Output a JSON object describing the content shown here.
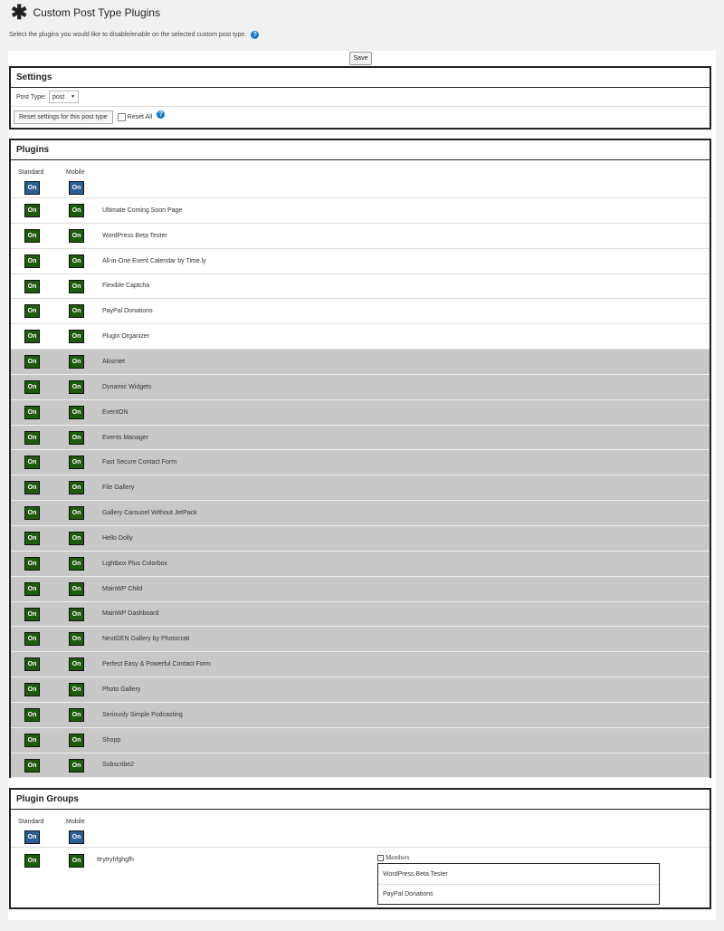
{
  "page": {
    "title": "Custom Post Type Plugins",
    "description": "Select the plugins you would like to disable/enable on the selected custom post type.",
    "save_label": "Save"
  },
  "settings": {
    "heading": "Settings",
    "post_type_label": "Post Type:",
    "post_type_value": "post",
    "reset_button": "Reset settings for this post type",
    "reset_all_label": "Reset All"
  },
  "plugins": {
    "heading": "Plugins",
    "col_standard": "Standard",
    "col_mobile": "Mobile",
    "toggle_label": "On",
    "items": [
      {
        "name": "Ultimate Coming Soon Page",
        "gray": false
      },
      {
        "name": "WordPress Beta Tester",
        "gray": false
      },
      {
        "name": "All-in-One Event Calendar by Time.ly",
        "gray": false
      },
      {
        "name": "Flexible Captcha",
        "gray": false
      },
      {
        "name": "PayPal Donations",
        "gray": false
      },
      {
        "name": "Plugin Organizer",
        "gray": false
      },
      {
        "name": "Akismet",
        "gray": true
      },
      {
        "name": "Dynamic Widgets",
        "gray": true
      },
      {
        "name": "EventON",
        "gray": true
      },
      {
        "name": "Events Manager",
        "gray": true
      },
      {
        "name": "Fast Secure Contact Form",
        "gray": true
      },
      {
        "name": "File Gallery",
        "gray": true
      },
      {
        "name": "Gallery Carousel Without JetPack",
        "gray": true
      },
      {
        "name": "Hello Dolly",
        "gray": true
      },
      {
        "name": "Lightbox Plus Colorbox",
        "gray": true
      },
      {
        "name": "MainWP Child",
        "gray": true
      },
      {
        "name": "MainWP Dashboard",
        "gray": true
      },
      {
        "name": "NextGEN Gallery by Photocrati",
        "gray": true
      },
      {
        "name": "Perfect Easy & Powerful Contact Form",
        "gray": true
      },
      {
        "name": "Photo Gallery",
        "gray": true
      },
      {
        "name": "Seriously Simple Podcasting",
        "gray": true
      },
      {
        "name": "Shopp",
        "gray": true
      },
      {
        "name": "Subscribe2",
        "gray": true
      }
    ]
  },
  "groups": {
    "heading": "Plugin Groups",
    "col_standard": "Standard",
    "col_mobile": "Mobile",
    "toggle_label": "On",
    "items": [
      {
        "name": "ttrytryhfghgfh",
        "members_label": "Members",
        "members": [
          "WordPress Beta Tester",
          "PayPal Donations"
        ]
      }
    ]
  },
  "icons": {
    "header": "asterisk-icon",
    "help": "help-icon",
    "dropdown": "chevron-down-icon",
    "collapse": "minus-box-icon"
  },
  "colors": {
    "on_blue": "#2b5f8f",
    "on_green": "#1d5c0a",
    "inactive_row": "#c8c8c8",
    "help": "#1a7bc8"
  }
}
